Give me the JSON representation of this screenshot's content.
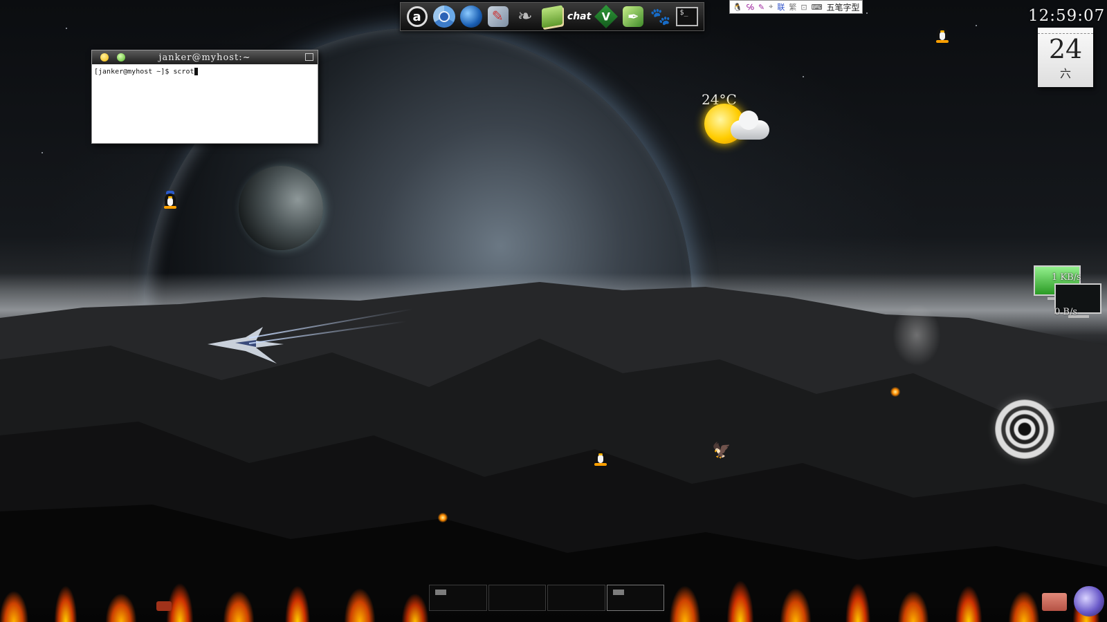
{
  "dock": {
    "items": [
      {
        "label": "a",
        "icon": "launcher-icon"
      },
      {
        "label": "",
        "icon": "chromium-icon"
      },
      {
        "label": "",
        "icon": "firefox-globe-icon"
      },
      {
        "label": "",
        "icon": "system-tools-icon"
      },
      {
        "label": "",
        "icon": "gnome-foot-icon"
      },
      {
        "label": "",
        "icon": "dictionary-book-icon"
      },
      {
        "label": "chat",
        "icon": "xchat-icon"
      },
      {
        "label": "V",
        "icon": "vim-icon"
      },
      {
        "label": "",
        "icon": "feather-editor-icon"
      },
      {
        "label": "",
        "icon": "gimp-icon"
      },
      {
        "label": "$_",
        "icon": "terminal-icon"
      }
    ]
  },
  "ime": {
    "items": [
      "联",
      "繁",
      "五笔字型"
    ]
  },
  "clock": {
    "time": "12:59:07"
  },
  "calendar": {
    "day": "24",
    "weekday": "六"
  },
  "weather": {
    "temperature": "24°C",
    "icon": "partly-cloudy-sun-icon"
  },
  "terminal": {
    "title": "janker@myhost:~",
    "prompt": "[janker@myhost ~]$ ",
    "command": "scrot"
  },
  "network": {
    "upload": "1 KB/s",
    "download": "0 B/s"
  },
  "colors": {
    "upload_screen": "#2a9a24",
    "flame": "#ffb400",
    "dock_bg": "#1e1e1e"
  }
}
